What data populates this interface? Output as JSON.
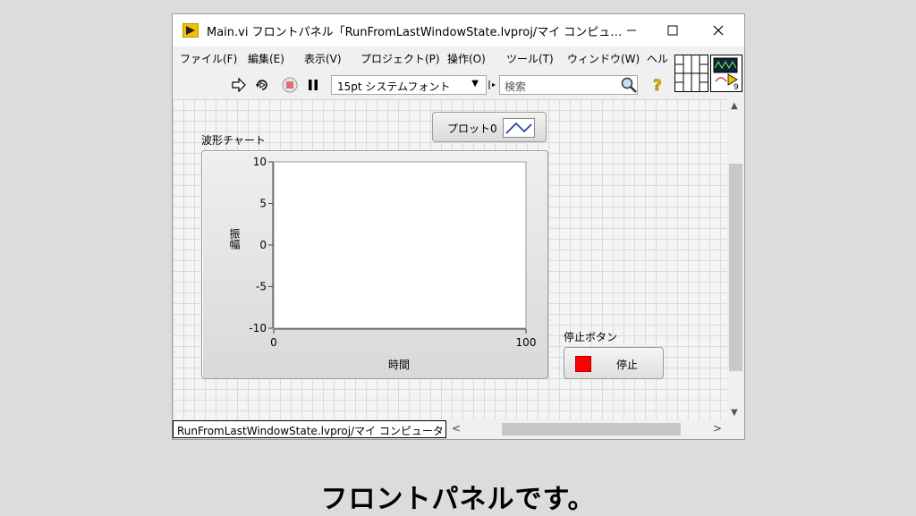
{
  "window": {
    "title": "Main.vi フロントパネル「RunFromLastWindowState.lvproj/マイ コンピュ…",
    "minimize_glyph": "—",
    "maximize_glyph": "☐",
    "close_glyph": "✕"
  },
  "menu": {
    "items": [
      "ファイル(F)",
      "編集(E)",
      "表示(V)",
      "プロジェクト(P)",
      "操作(O)",
      "ツール(T)",
      "ウィンドウ(W)",
      "ヘル"
    ]
  },
  "toolbar": {
    "run_glyph": "⇨",
    "run_continuous_glyph": "⟲",
    "pause_glyph": "❚❚",
    "font_select_value": "15pt システムフォント",
    "font_select_arrow": "▼",
    "search_placeholder": "検索",
    "help_glyph": "?"
  },
  "vi_icon": {
    "number": "9"
  },
  "front_panel": {
    "chart": {
      "label": "波形チャート",
      "x_label": "時間",
      "y_label": "振幅",
      "legend_plot_name": "プロット0"
    },
    "stop_button": {
      "label": "停止ボタン",
      "text": "停止"
    }
  },
  "status": {
    "context": "RunFromLastWindowState.lvproj/マイ コンピュータ",
    "scroll_left_glyph": "<",
    "scroll_right_glyph": ">",
    "scroll_up_glyph": "▲",
    "scroll_down_glyph": "▼"
  },
  "caption": "フロントパネルです。",
  "colors": {
    "stop_button_indicator": "#ff0000",
    "help_icon": "#e8b800",
    "app_icon": "#f0c000"
  },
  "chart_data": {
    "type": "line",
    "title": "波形チャート",
    "xlabel": "時間",
    "ylabel": "振幅",
    "xlim": [
      0,
      100
    ],
    "ylim": [
      -10,
      10
    ],
    "x_ticks": [
      0,
      100
    ],
    "y_ticks": [
      10,
      5,
      0,
      -5,
      -10
    ],
    "series": [
      {
        "name": "プロット0",
        "values": []
      }
    ],
    "grid": false,
    "legend": "top-right"
  }
}
